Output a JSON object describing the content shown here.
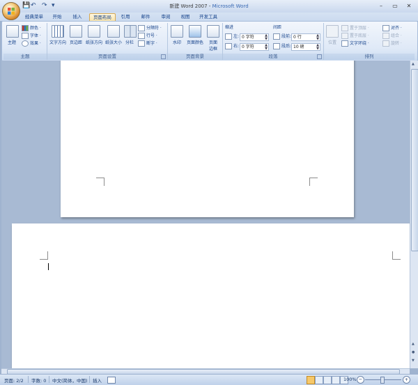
{
  "window": {
    "title_doc": "新建 Word 2007",
    "title_sep": " - ",
    "title_app": "Microsoft Word"
  },
  "quick_access": {
    "save": "💾",
    "undo": "↶",
    "redo": "↷",
    "more": "▾"
  },
  "window_controls": {
    "minimize": "–",
    "maximize": "▭",
    "close": "✕"
  },
  "tabs": [
    {
      "label": "经典菜单"
    },
    {
      "label": "开始"
    },
    {
      "label": "插入"
    },
    {
      "label": "页面布局"
    },
    {
      "label": "引用"
    },
    {
      "label": "邮件"
    },
    {
      "label": "审阅"
    },
    {
      "label": "视图"
    },
    {
      "label": "开发工具"
    }
  ],
  "active_tab": "页面布局",
  "ribbon": {
    "theme": {
      "label": "主题",
      "theme_btn": "主题",
      "colors": "颜色 ·",
      "fonts": "字体 ·",
      "effects": "效果 ·"
    },
    "page_setup": {
      "label": "页面设置",
      "text_direction": "文字方向",
      "margins": "页边距",
      "orientation": "纸张方向",
      "size": "纸张大小",
      "columns": "分栏",
      "breaks": "分隔符 ·",
      "line_numbers": "行号 ·",
      "hyphenation": "断字 ·"
    },
    "page_background": {
      "label": "页面背景",
      "watermark": "水印",
      "page_color": "页面颜色",
      "page_borders_1": "页面",
      "page_borders_2": "边框"
    },
    "paragraph": {
      "label": "段落",
      "indent_header": "缩进",
      "spacing_header": "间距",
      "left_label": "左:",
      "left_value": "0 字符",
      "right_label": "右:",
      "right_value": "0 字符",
      "before_label": "段前:",
      "before_value": "0 行",
      "after_label": "段后:",
      "after_value": "10 磅"
    },
    "arrange": {
      "label": "排列",
      "position": "位置",
      "bring_front": "置于顶层 ·",
      "send_back": "置于底层 ·",
      "text_wrap": "文字环绕 ·",
      "align": "对齐 ·",
      "group": "组合 ·",
      "rotate": "旋转 ·"
    }
  },
  "statusbar": {
    "page": "页面: 2/2",
    "words": "字数: 0",
    "language": "中文(简体，中国)",
    "mode": "插入",
    "zoom": "100%",
    "zoom_minus": "−",
    "zoom_plus": "+"
  },
  "colors": {
    "ribbon_text": "#15428b",
    "active_tab_bg": "#f8e2a6",
    "document_bg": "#a8bad3"
  }
}
